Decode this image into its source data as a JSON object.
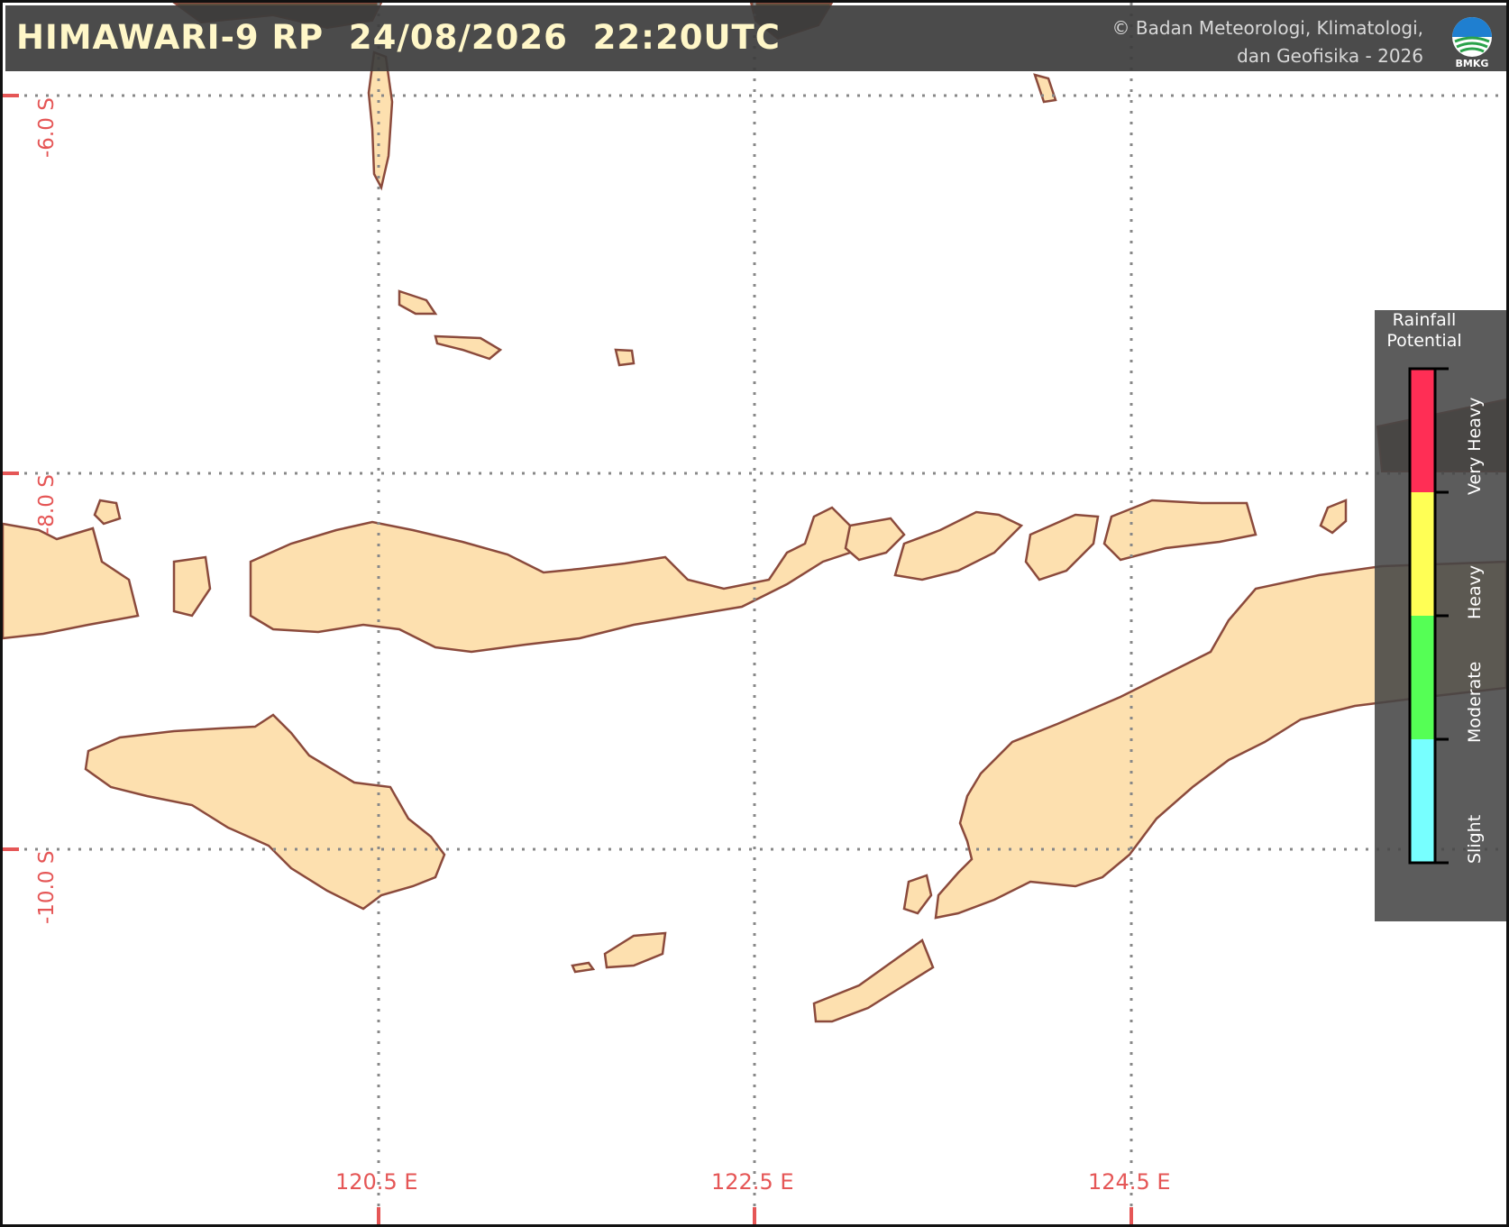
{
  "header": {
    "title": "HIMAWARI-9 RP  24/08/2026  22:20UTC",
    "copyright_line1": "© Badan Meteorologi, Klimatologi,",
    "copyright_line2": "dan Geofisika -  2026",
    "logo_text": "BMKG",
    "logo_icon": "bmkg-logo-icon"
  },
  "map": {
    "longitude_labels": [
      "120.5 E",
      "122.5 E",
      "124.5 E"
    ],
    "latitude_labels": [
      "-6.0 S",
      "-8.0 S",
      "-10.0 S"
    ],
    "land_color": "#fde0af",
    "coast_color": "#8b4a3c",
    "gridline_color": "#888888",
    "axis_label_color": "#e55656"
  },
  "legend": {
    "title_line1": "Rainfall",
    "title_line2": "Potential",
    "categories": [
      {
        "label": "Very Heavy",
        "color": "#ff2e55"
      },
      {
        "label": "Heavy",
        "color": "#ffff55"
      },
      {
        "label": "Moderate",
        "color": "#55ff55"
      },
      {
        "label": "Slight",
        "color": "#77ffff"
      }
    ]
  }
}
